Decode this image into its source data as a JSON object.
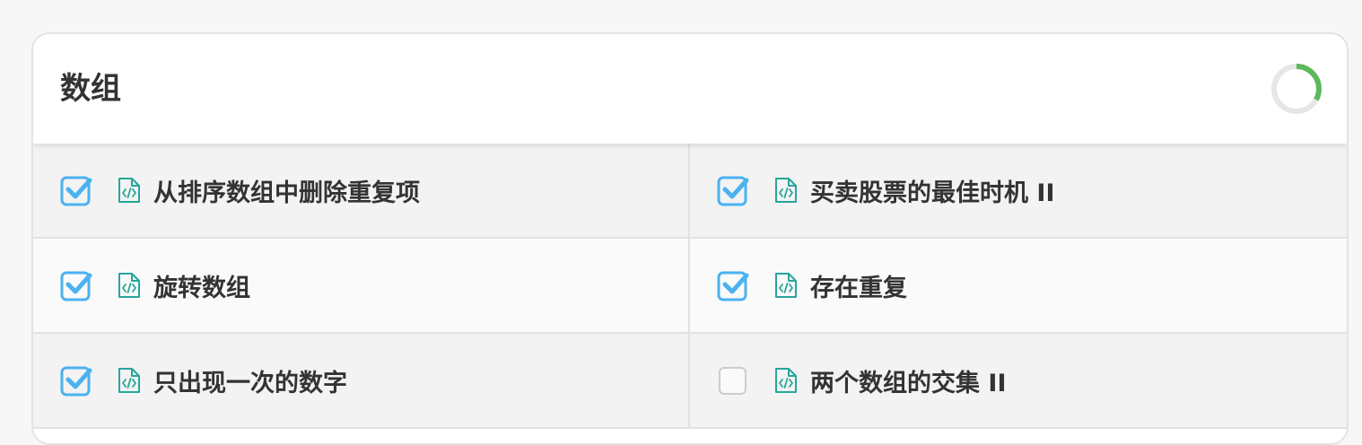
{
  "card": {
    "title": "数组",
    "progress_fraction": 0.33
  },
  "colors": {
    "checkbox_checked": "#4bb2f0",
    "checkbox_unchecked": "#cccccc",
    "file_icon": "#26a69a",
    "progress": "#5cb85c",
    "progress_track": "#e6e6e6"
  },
  "problems": [
    {
      "label": "从排序数组中删除重复项",
      "done": true,
      "icon": "code-file-icon"
    },
    {
      "label": "买卖股票的最佳时机 II",
      "done": true,
      "icon": "code-file-icon"
    },
    {
      "label": "旋转数组",
      "done": true,
      "icon": "code-file-icon"
    },
    {
      "label": "存在重复",
      "done": true,
      "icon": "code-file-icon"
    },
    {
      "label": "只出现一次的数字",
      "done": true,
      "icon": "code-file-icon"
    },
    {
      "label": "两个数组的交集 II",
      "done": false,
      "icon": "code-file-icon"
    }
  ]
}
